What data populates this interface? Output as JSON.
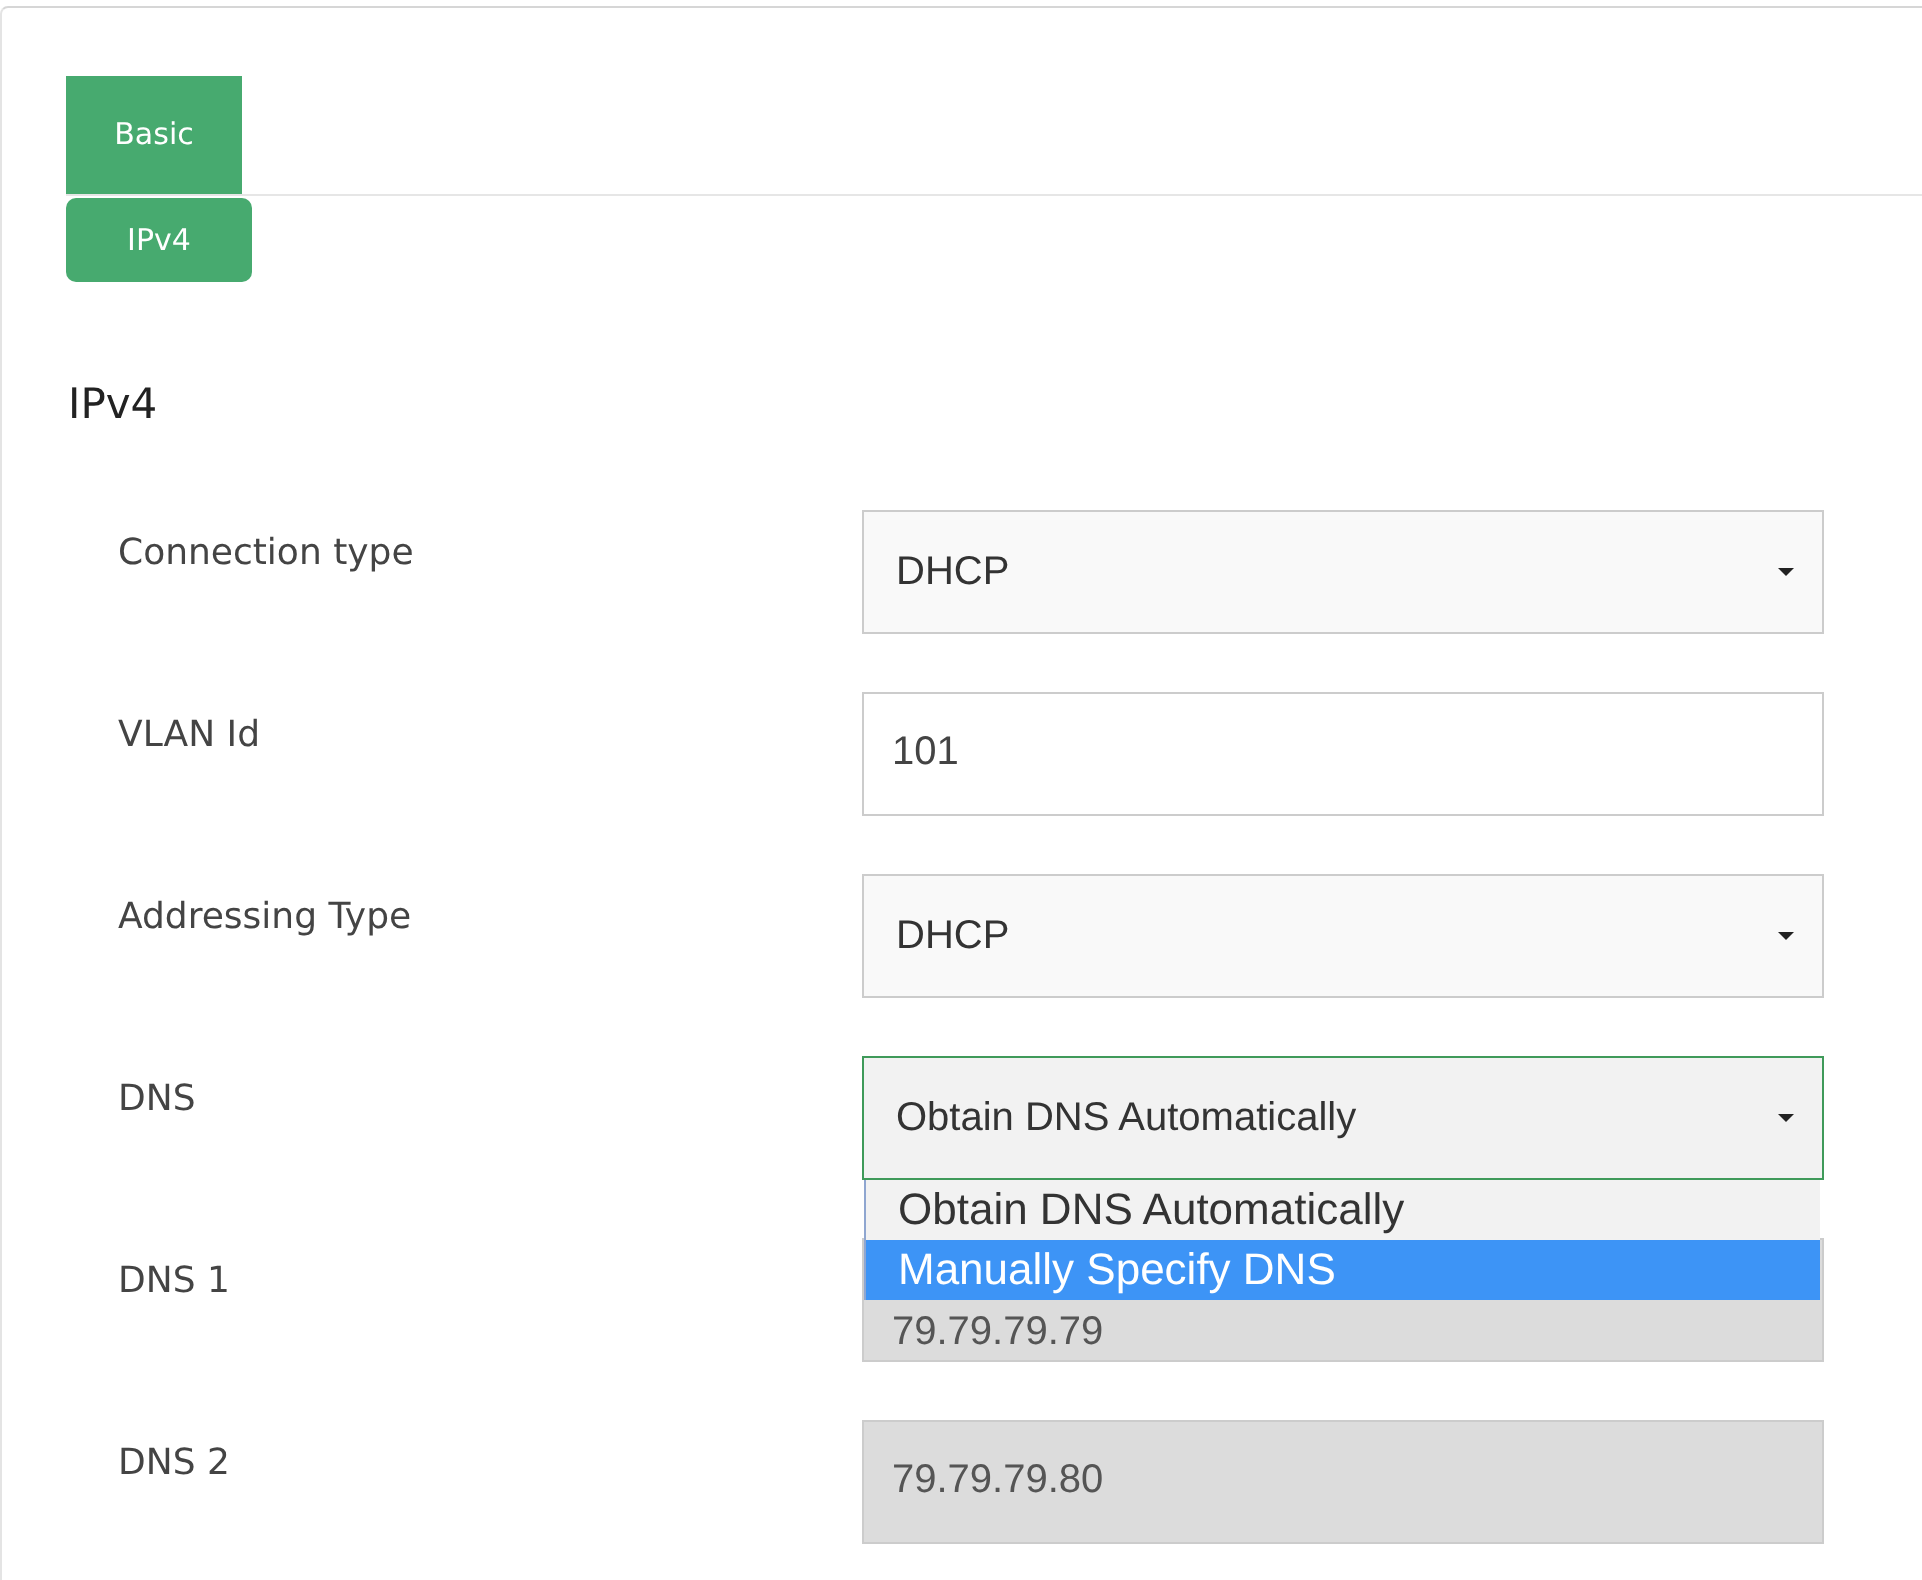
{
  "tabs": [
    {
      "label": "Basic",
      "selected": true
    }
  ],
  "subtabs": [
    {
      "label": "IPv4",
      "selected": true
    }
  ],
  "section_title": "IPv4",
  "fields": [
    {
      "label": "Connection type",
      "kind": "select",
      "value": "DHCP",
      "disabled": false,
      "focused": false
    },
    {
      "label": "VLAN Id",
      "kind": "input",
      "value": "101",
      "disabled": false,
      "focused": false
    },
    {
      "label": "Addressing Type",
      "kind": "select",
      "value": "DHCP",
      "disabled": false,
      "focused": false
    },
    {
      "label": "DNS",
      "kind": "select",
      "value": "Obtain DNS Automatically",
      "disabled": false,
      "focused": true,
      "expanded": true,
      "options": [
        {
          "label": "Obtain DNS Automatically",
          "highlighted": false
        },
        {
          "label": "Manually Specify DNS",
          "highlighted": true
        }
      ]
    },
    {
      "label": "DNS 1",
      "kind": "input",
      "value": "79.79.79.79",
      "disabled": true,
      "focused": false
    },
    {
      "label": "DNS 2",
      "kind": "input",
      "value": "79.79.79.80",
      "disabled": true,
      "focused": false
    }
  ]
}
